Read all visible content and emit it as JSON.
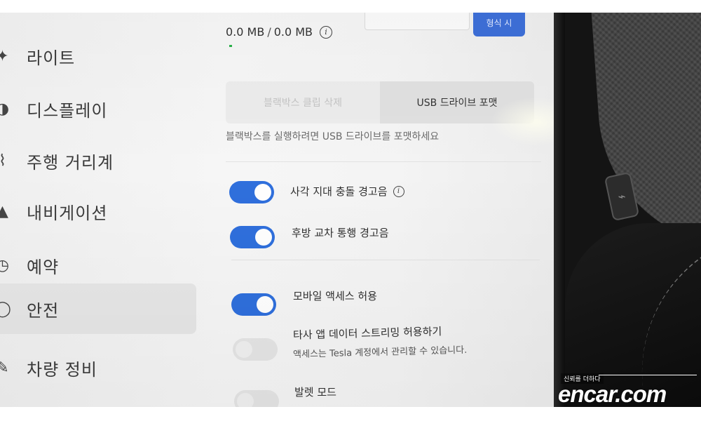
{
  "sidebar": {
    "items": [
      {
        "label": "라이트",
        "icon": "light-icon",
        "active": false
      },
      {
        "label": "디스플레이",
        "icon": "display-icon",
        "active": false
      },
      {
        "label": "주행 거리계",
        "icon": "trip-icon",
        "active": false
      },
      {
        "label": "내비게이션",
        "icon": "navigation-icon",
        "active": false
      },
      {
        "label": "예약",
        "icon": "schedule-icon",
        "active": false
      },
      {
        "label": "안전",
        "icon": "safety-icon",
        "active": true
      },
      {
        "label": "차량 정비",
        "icon": "wrench-icon",
        "active": false
      }
    ]
  },
  "top": {
    "button_label": "형식 시"
  },
  "storage": {
    "used": "0.0 MB",
    "separator": "/",
    "total": "0.0 MB"
  },
  "dashcam": {
    "delete_clips_label": "블랙박스 클립 삭제",
    "format_usb_label": "USB 드라이브 포맷",
    "hint": "블랙박스를 실행하려면 USB 드라이브를 포맷하세요"
  },
  "toggles": [
    {
      "label": "사각 지대 충돌 경고음",
      "on": true,
      "has_info": true
    },
    {
      "label": "후방 교차 통행 경고음",
      "on": true,
      "has_info": false
    },
    {
      "label": "모바일 액세스 허용",
      "on": true,
      "has_info": false
    },
    {
      "label": "타사 앱 데이터 스트리밍 허용하기",
      "sublabel": "액세스는 Tesla 계정에서 관리할 수 있습니다.",
      "on": false,
      "has_info": false
    },
    {
      "label": "발렛 모드",
      "on": false,
      "has_info": false
    }
  ],
  "watermark": {
    "tagline": "신뢰를 더하다",
    "logo": "encar.com"
  },
  "colors": {
    "accent": "#2f6fdc",
    "background": "#f4f4f4",
    "active_sidebar": "#e6e6e6"
  }
}
